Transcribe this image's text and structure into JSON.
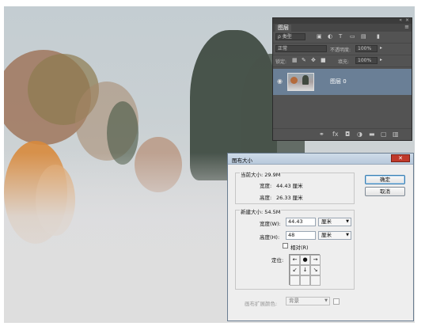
{
  "layers_panel": {
    "tab_label": "图层",
    "menu_icon": "panel-menu-icon",
    "kind_filter": "ρ 类型",
    "blend_mode": "正常",
    "opacity_label": "不透明度:",
    "opacity_value": "100%",
    "lock_label": "锁定:",
    "fill_label": "填充:",
    "fill_value": "100%",
    "layer_name": "图层 0",
    "bottom_icons": [
      "link-icon",
      "fx-icon",
      "mask-icon",
      "adjustment-icon",
      "folder-icon",
      "new-layer-icon",
      "trash-icon"
    ]
  },
  "dialog": {
    "title": "图布大小",
    "close_label": "✕",
    "current_size_label": "当前大小: 29.9M",
    "current_width_label": "宽度:",
    "current_width_value": "44.43 厘米",
    "current_height_label": "高度:",
    "current_height_value": "26.33 厘米",
    "new_size_label": "新建大小: 54.5M",
    "width_label": "宽度(W):",
    "width_value": "44.43",
    "width_unit": "厘米",
    "height_label": "高度(H):",
    "height_value": "48",
    "height_unit": "厘米",
    "relative_label": "相对(R)",
    "anchor_label": "定位:",
    "anchor_arrows": [
      "←",
      "●",
      "→",
      "↙",
      "↓",
      "↘",
      "",
      "",
      ""
    ],
    "extension_color_label": "画布扩展颜色:",
    "extension_color_value": "背景",
    "ok_label": "确定",
    "cancel_label": "取消"
  }
}
